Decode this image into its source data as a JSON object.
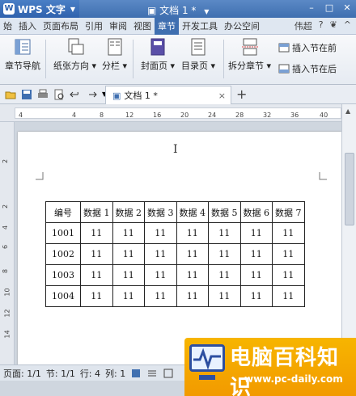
{
  "titlebar": {
    "app_name": "WPS 文字",
    "doc_title": "文档 1 *"
  },
  "tabs": {
    "items": [
      "始",
      "插入",
      "页面布局",
      "引用",
      "审阅",
      "视图",
      "章节",
      "开发工具",
      "办公空间"
    ],
    "active": "章节",
    "right_label": "伟超"
  },
  "ribbon": {
    "nav_label": "章节导航",
    "orientation_label": "纸张方向",
    "columns_label": "分栏",
    "cover_label": "封面页",
    "toc_label": "目录页",
    "split_label": "拆分章节",
    "insert_before_label": "插入节在前",
    "insert_after_label": "插入节在后"
  },
  "doc_tab": {
    "label": "文档 1 *",
    "close": "×",
    "new_tab": "+"
  },
  "ruler": {
    "ticks": [
      "4",
      "4",
      "8",
      "12",
      "16",
      "20",
      "24",
      "28",
      "32",
      "36",
      "40"
    ]
  },
  "vruler": {
    "ticks": [
      "2",
      "2",
      "4",
      "6",
      "8",
      "10",
      "12",
      "14"
    ]
  },
  "table": {
    "headers": [
      "编号",
      "数据 1",
      "数据 2",
      "数据 3",
      "数据 4",
      "数据 5",
      "数据 6",
      "数据 7"
    ],
    "rows": [
      [
        "1001",
        "11",
        "11",
        "11",
        "11",
        "11",
        "11",
        "11"
      ],
      [
        "1002",
        "11",
        "11",
        "11",
        "11",
        "11",
        "11",
        "11"
      ],
      [
        "1003",
        "11",
        "11",
        "11",
        "11",
        "11",
        "11",
        "11"
      ],
      [
        "1004",
        "11",
        "11",
        "11",
        "11",
        "11",
        "11",
        "11"
      ]
    ]
  },
  "statusbar": {
    "page": "页面: 1/1",
    "section": "节: 1/1",
    "row": "行: 4",
    "col": "列: 1"
  },
  "watermark": {
    "title": "电脑百科知识",
    "url": "www.pc-daily.com"
  },
  "colors": {
    "title_bar": "#3f6fb0",
    "active_tab": "#3f6fb0",
    "watermark": "#f7b500"
  }
}
